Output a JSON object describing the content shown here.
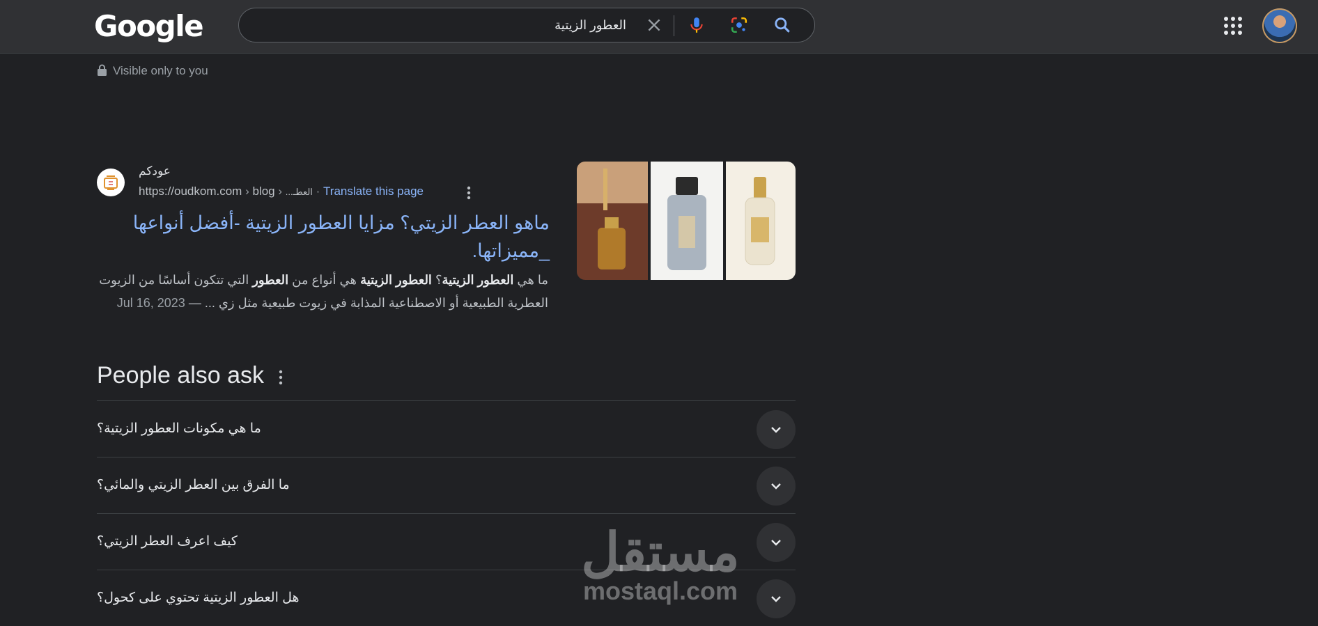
{
  "header": {
    "logo_text": "Google",
    "search_query": "العطور الزيتية"
  },
  "notice": {
    "visibility": "Visible only to you"
  },
  "result": {
    "site_name": "عودكم",
    "url_base": "https://oudkom.com",
    "url_path1": "blog",
    "url_path2": "...العطـ",
    "translate_label": "Translate this page",
    "title": "ماهو العطر الزيتي؟ مزايا العطور الزيتية -أفضل أنواعها _مميزاتها.",
    "date": "Jul 16, 2023",
    "snippet": {
      "p1": "ما هي ",
      "b1": "العطور الزيتية",
      "p2": "؟ ",
      "b2": "العطور الزيتية",
      "p3": " هي أنواع من ",
      "b3": "العطور",
      "p4": " التي تتكون أساسًا من الزيوت العطرية الطبيعية أو الاصطناعية المذابة في زيوت طبيعية مثل زي ..."
    }
  },
  "people_also_ask": {
    "title": "People also ask",
    "questions": [
      "ما هي مكونات العطور الزيتية؟",
      "ما الفرق بين العطر الزيتي والمائي؟",
      "كيف اعرف العطر الزيتي؟",
      "هل العطور الزيتية تحتوي على كحول؟"
    ]
  },
  "watermark": {
    "arabic": "مستقل",
    "latin": "mostaql.com"
  }
}
